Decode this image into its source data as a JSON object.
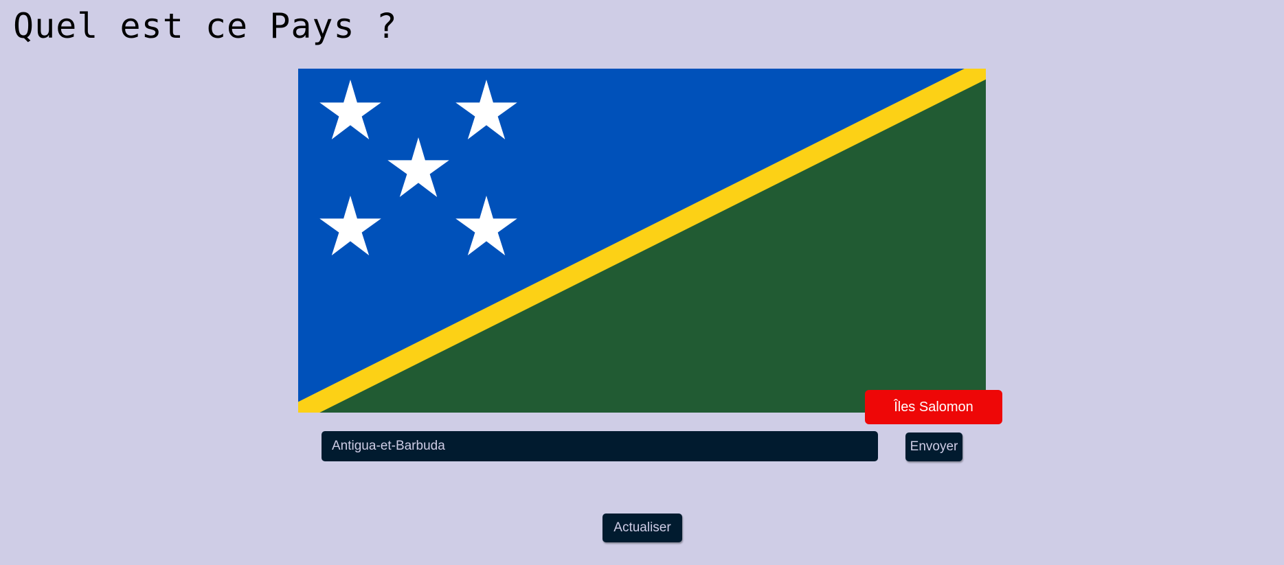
{
  "page": {
    "title": "Quel est ce Pays ?"
  },
  "flag": {
    "country": "Îles Salomon",
    "colors": {
      "blue": "#0051ba",
      "green": "#215b33",
      "yellow": "#fcd116",
      "stars": "#ffffff"
    },
    "star_count": 5
  },
  "result": {
    "answer": "Îles Salomon",
    "status": "incorrect",
    "color": "#ee0707"
  },
  "guess": {
    "value": "Antigua-et-Barbuda",
    "placeholder": ""
  },
  "buttons": {
    "submit_label": "Envoyer",
    "refresh_label": "Actualiser"
  },
  "theme": {
    "background": "#cfcde6",
    "control_bg": "#011b2f",
    "control_text": "#cfcde6"
  }
}
